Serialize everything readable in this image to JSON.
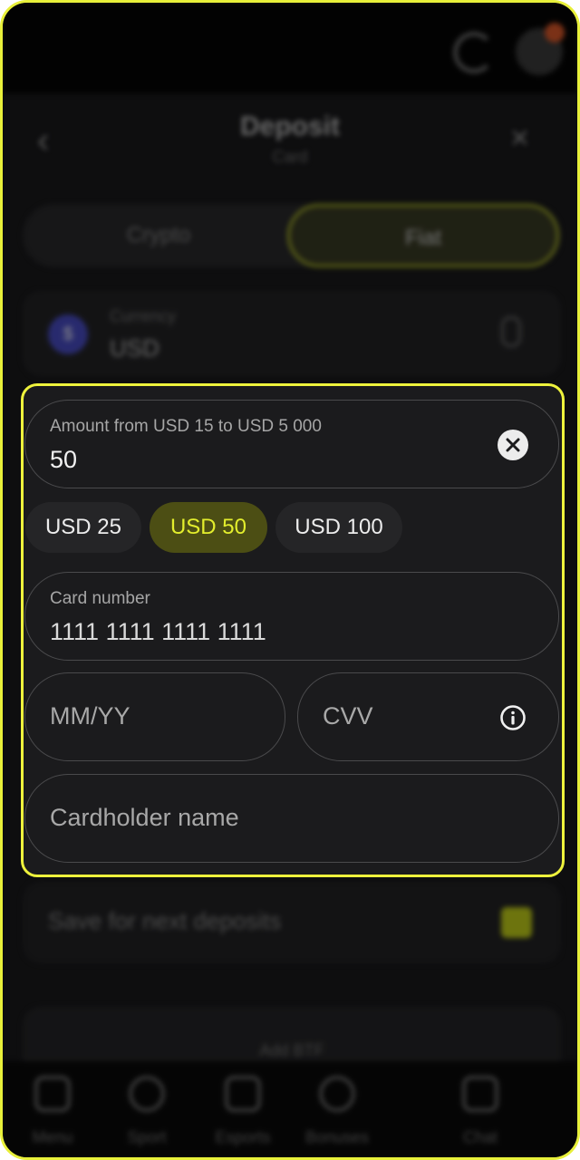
{
  "background": {
    "header": {
      "title": "Deposit",
      "subtitle": "Card",
      "back_icon": "chevron-left-icon",
      "close_icon": "close-icon"
    },
    "tabs": [
      {
        "label": "Crypto"
      },
      {
        "label": "Fiat"
      }
    ],
    "currency": {
      "label": "Currency",
      "value": "USD",
      "coin_symbol": "$"
    },
    "save_option": {
      "label": "Save for next deposits"
    },
    "bottom_card": {
      "text": "Add BTF"
    },
    "nav": [
      {
        "label": "Menu",
        "icon": "grid-icon"
      },
      {
        "label": "Sport",
        "icon": "ball-icon"
      },
      {
        "label": "Esports",
        "icon": "gamepad-icon"
      },
      {
        "label": "Bonuses",
        "icon": "gift-icon"
      },
      {
        "label": "Chat",
        "icon": "chat-icon"
      }
    ]
  },
  "form": {
    "amount": {
      "label": "Amount from USD 15 to USD 5 000",
      "value": "50"
    },
    "quick_amounts": [
      {
        "label": "USD 25"
      },
      {
        "label": "USD 50",
        "selected": true
      },
      {
        "label": "USD 100"
      }
    ],
    "card_number": {
      "label": "Card number",
      "value": "1111 1111 1111 1111"
    },
    "expiry": {
      "placeholder": "MM/YY"
    },
    "cvv": {
      "placeholder": "CVV"
    },
    "cardholder": {
      "placeholder": "Cardholder name"
    }
  },
  "colors": {
    "highlight": "#eef23c",
    "selected_chip_bg": "#4c4e14",
    "selected_chip_text": "#e3ee2d",
    "surface": "#1b1b1d"
  }
}
